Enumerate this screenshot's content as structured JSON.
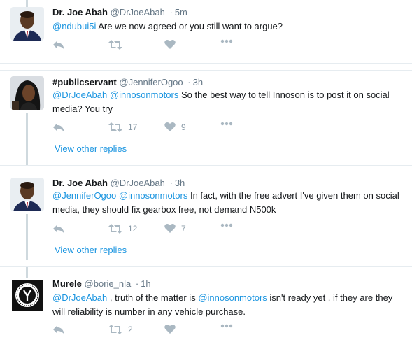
{
  "tweets": [
    {
      "name": "Dr. Joe Abah",
      "handle": "@DrJoeAbah",
      "separator": "·",
      "time": "5m",
      "text_parts": [
        {
          "mention": "@ndubui5i"
        },
        {
          "plain": " Are we now agreed or you still want to argue?"
        }
      ],
      "retweets": "",
      "likes": "",
      "avatar_icon": "person-suit-icon"
    },
    {
      "name": "#publicservant",
      "handle": "@JenniferOgoo",
      "separator": "·",
      "time": "3h",
      "mention1": "@DrJoeAbah",
      "mention2": "@innosonmotors",
      "plain": " So the best way to tell Innoson is to post it on social media? You try",
      "retweets": "17",
      "likes": "9",
      "view_replies": "View other replies",
      "avatar_icon": "woman-portrait-icon"
    },
    {
      "name": "Dr. Joe Abah",
      "handle": "@DrJoeAbah",
      "separator": "·",
      "time": "3h",
      "mention1": "@JenniferOgoo",
      "mention2": "@innosonmotors",
      "plain": " In fact, with the free advert I've given them on social media, they should fix gearbox free, not demand N500k",
      "retweets": "12",
      "likes": "7",
      "view_replies": "View other replies",
      "avatar_icon": "person-suit-icon"
    },
    {
      "name": "Murele",
      "handle": "@borie_nla",
      "separator": "·",
      "time": "1h",
      "mention1": "@DrJoeAbah",
      "mid": " , truth of the matter is ",
      "mention2": "@innosonmotors",
      "plain": " isn't ready yet , if they are they will reliability is number in any vehicle purchase.",
      "retweets": "2",
      "likes": "",
      "avatar_icon": "union-logo-icon"
    }
  ],
  "colors": {
    "link": "#1b95e0",
    "muted": "#657786",
    "icon": "#aab8c2",
    "divider": "#e6ecf0"
  }
}
